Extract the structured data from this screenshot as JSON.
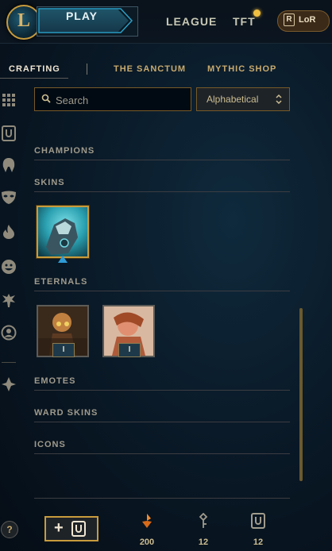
{
  "topbar": {
    "logo_letter": "L",
    "play_label": "PLAY",
    "nav": [
      {
        "label": "LEAGUE"
      },
      {
        "label": "TFT"
      }
    ],
    "lor_icon_letter": "R",
    "lor_label": "LoR"
  },
  "subnav": {
    "tabs": [
      {
        "label": "CRAFTING",
        "active": true
      },
      {
        "label": "THE SANCTUM"
      },
      {
        "label": "MYTHIC SHOP"
      }
    ]
  },
  "rail": {
    "icons": [
      "grid-icon",
      "ward-chest-icon",
      "champion-helmet-icon",
      "mask-icon",
      "flame-icon",
      "emote-face-icon",
      "tree-icon",
      "profile-icon",
      "crest-icon"
    ]
  },
  "filters": {
    "search_placeholder": "Search",
    "sort_value": "Alphabetical"
  },
  "sections": [
    {
      "title": "CHAMPIONS"
    },
    {
      "title": "SKINS"
    },
    {
      "title": "ETERNALS"
    },
    {
      "title": "EMOTES"
    },
    {
      "title": "WARD SKINS"
    },
    {
      "title": "ICONS"
    }
  ],
  "eternals": [
    {
      "badge": "I"
    },
    {
      "badge": "I"
    }
  ],
  "bottom": {
    "help_label": "?",
    "add_plus": "+",
    "currencies": [
      {
        "icon": "orange-essence-icon",
        "value": "200"
      },
      {
        "icon": "key-icon",
        "value": "12"
      },
      {
        "icon": "chest-icon",
        "value": "12"
      }
    ]
  },
  "colors": {
    "gold": "#c89b3c",
    "accent_blue": "#2f9bd6",
    "background": "#0a1a28"
  }
}
